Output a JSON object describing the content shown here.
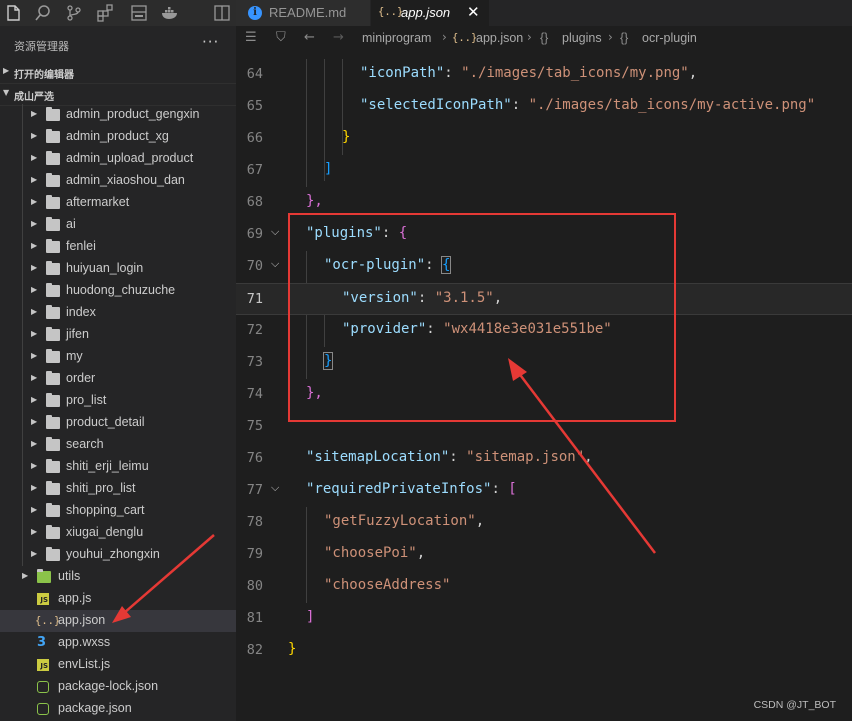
{
  "sidebar": {
    "explorer_title": "资源管理器",
    "more_label": "···",
    "open_editors_label": "打开的编辑器",
    "project_label": "成山严选",
    "activity_icons": [
      "files-icon",
      "search-icon",
      "source-control-icon",
      "extensions-icon",
      "panel-icon",
      "docker-icon",
      "split-icon"
    ]
  },
  "tree": {
    "folders": [
      "admin_product_gengxin",
      "admin_product_xg",
      "admin_upload_product",
      "admin_xiaoshou_dan",
      "aftermarket",
      "ai",
      "fenlei",
      "huiyuan_login",
      "huodong_chuzuche",
      "index",
      "jifen",
      "my",
      "order",
      "pro_list",
      "product_detail",
      "search",
      "shiti_erji_leimu",
      "shiti_pro_list",
      "shopping_cart",
      "xiugai_denglu",
      "youhui_zhongxin"
    ],
    "utils_label": "utils",
    "files": [
      {
        "name": "app.js",
        "icon": "JS",
        "color": "#cbcb41"
      },
      {
        "name": "app.json",
        "icon": "{..}",
        "color": "#e2c08d",
        "selected": true
      },
      {
        "name": "app.wxss",
        "icon": "3",
        "color": "#42a5f5"
      },
      {
        "name": "envList.js",
        "icon": "JS",
        "color": "#cbcb41"
      },
      {
        "name": "package-lock.json",
        "icon": "npm",
        "color": "#8bc34a"
      },
      {
        "name": "package.json",
        "icon": "npm",
        "color": "#8bc34a"
      }
    ]
  },
  "tabs": {
    "readme": "README.md",
    "active": "app.json",
    "json_badge": "{..}",
    "info_glyph": "i",
    "close_glyph": "✕"
  },
  "breadcrumb": {
    "folder": "miniprogram",
    "file": "app.json",
    "obj1_icon": "{}",
    "obj1": "plugins",
    "obj2_icon": "{}",
    "obj2": "ocr-plugin"
  },
  "code": {
    "line_numbers": [
      "64",
      "65",
      "66",
      "67",
      "68",
      "69",
      "70",
      "71",
      "72",
      "73",
      "74",
      "75",
      "76",
      "77",
      "78",
      "79",
      "80",
      "81",
      "82"
    ],
    "current_line": "71",
    "l64_key": "\"iconPath\"",
    "l64_val": "\"./images/tab_icons/my.png\"",
    "l65_key": "\"selectedIconPath\"",
    "l65_val": "\"./images/tab_icons/my-active.png\"",
    "l66": "}",
    "l67": "]",
    "l68": "},",
    "l69_key": "\"plugins\"",
    "l69_open": "{",
    "l70_key": "\"ocr-plugin\"",
    "l70_open": "{",
    "l71_key": "\"version\"",
    "l71_val": "\"3.1.5\"",
    "l72_key": "\"provider\"",
    "l72_val": "\"wx4418e3e031e551be\"",
    "l73": "}",
    "l74": "},",
    "l76_key": "\"sitemapLocation\"",
    "l76_val": "\"sitemap.json\"",
    "l77_key": "\"requiredPrivateInfos\"",
    "l77_open": "[",
    "l78": "\"getFuzzyLocation\"",
    "l79": "\"choosePoi\"",
    "l80": "\"chooseAddress\"",
    "l81": "]",
    "l82": "}",
    "colon": ": ",
    "comma": ","
  },
  "annotation": {
    "color": "#e53935"
  },
  "watermark": "CSDN @JT_BOT"
}
